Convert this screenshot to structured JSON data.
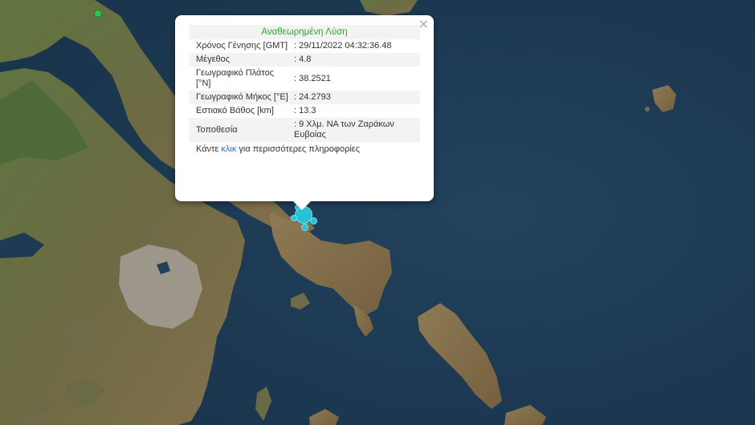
{
  "popup": {
    "title": "Αναθεωρημένη Λύση",
    "close_label": "×",
    "rows": [
      {
        "label": "Χρόνος Γένησης [GMT]",
        "value": ": 29/11/2022 04:32:36.48"
      },
      {
        "label": "Μέγεθος",
        "value": ": 4.8"
      },
      {
        "label": "Γεωγραφικό Πλάτος [°N]",
        "value": ": 38.2521"
      },
      {
        "label": "Γεωγραφικό Μήκος [°E]",
        "value": ": 24.2793"
      },
      {
        "label": "Εστιακό Βάθος [km]",
        "value": ": 13.3"
      },
      {
        "label": "Τοποθεσία",
        "value": ": 9 Χλμ. ΝΑ των Ζαράκων Ευβοίας"
      }
    ],
    "more_prefix": "Κάντε",
    "more_link": "κλικ",
    "more_suffix": "για περισσότερες πληροφορίες"
  },
  "colors": {
    "sea": "#1d3a52",
    "land": "#5a6a3a",
    "land_dry": "#8a7350",
    "city": "#a8a29a",
    "quake_marker": "#28c2d6",
    "title_green": "#2ba82b",
    "link_blue": "#2a6fc9"
  },
  "markers": {
    "earthquake_icon": "circle",
    "station_icon": "green-dot"
  }
}
